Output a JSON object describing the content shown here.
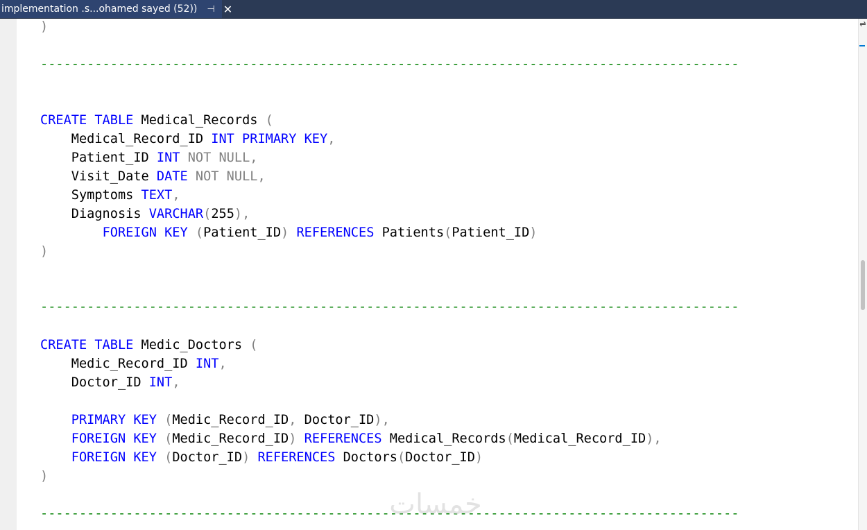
{
  "tab": {
    "title": "implementation .s...ohamed sayed (52))",
    "pin_icon": "pin-icon",
    "close_icon": "close-icon"
  },
  "code": {
    "lines": {
      "l1": {
        "p1": ")"
      },
      "sep1": "------------------------------------------------------------------------------------------",
      "l2": {
        "kw1": "CREATE TABLE",
        "id1": " Medical_Records ",
        "gr1": "("
      },
      "l3": {
        "id1": "    Medical_Record_ID ",
        "kw1": "INT PRIMARY KEY",
        "gr1": ","
      },
      "l4": {
        "id1": "    Patient_ID ",
        "kw1": "INT",
        "gr1": " NOT NULL,"
      },
      "l5": {
        "id1": "    Visit_Date ",
        "kw1": "DATE",
        "gr1": " NOT NULL,"
      },
      "l6": {
        "id1": "    Symptoms ",
        "kw1": "TEXT",
        "gr1": ","
      },
      "l7": {
        "id1": "    Diagnosis ",
        "kw1": "VARCHAR",
        "gr1": "(",
        "id2": "255",
        "gr2": "),"
      },
      "l8": {
        "sp": "        ",
        "kw1": "FOREIGN KEY",
        "gr1": " (",
        "id1": "Patient_ID",
        "gr2": ")",
        "kw2": " REFERENCES",
        "id2": " Patients",
        "gr3": "(",
        "id3": "Patient_ID",
        "gr4": ")"
      },
      "l9": {
        "p1": ")"
      },
      "sep2": "------------------------------------------------------------------------------------------",
      "l10": {
        "kw1": "CREATE TABLE",
        "id1": " Medic_Doctors ",
        "gr1": "("
      },
      "l11": {
        "id1": "    Medic_Record_ID ",
        "kw1": "INT",
        "gr1": ","
      },
      "l12": {
        "id1": "    Doctor_ID ",
        "kw1": "INT",
        "gr1": ","
      },
      "l13": {
        "sp": "    ",
        "kw1": "PRIMARY KEY",
        "gr1": " (",
        "id1": "Medic_Record_ID",
        "gr2": ",",
        "id2": " Doctor_ID",
        "gr3": "),"
      },
      "l14": {
        "sp": "    ",
        "kw1": "FOREIGN KEY",
        "gr1": " (",
        "id1": "Medic_Record_ID",
        "gr2": ")",
        "kw2": " REFERENCES",
        "id2": " Medical_Records",
        "gr3": "(",
        "id3": "Medical_Record_ID",
        "gr4": "),"
      },
      "l15": {
        "sp": "    ",
        "kw1": "FOREIGN KEY",
        "gr1": " (",
        "id1": "Doctor_ID",
        "gr2": ")",
        "kw2": " REFERENCES",
        "id2": " Doctors",
        "gr3": "(",
        "id3": "Doctor_ID",
        "gr4": ")"
      },
      "l16": {
        "p1": ")"
      },
      "sep3": "------------------------------------------------------------------------------------------"
    }
  },
  "watermark": {
    "text": "خمسات"
  },
  "colors": {
    "keyword": "#0000ff",
    "punctuation": "#808080",
    "identifier": "#000000",
    "comment": "#008000",
    "tab_background": "#2e4470"
  }
}
